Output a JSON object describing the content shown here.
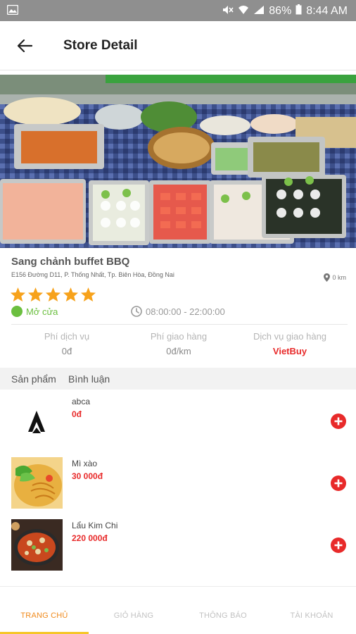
{
  "status_bar": {
    "battery": "86%",
    "time": "8:44 AM"
  },
  "header": {
    "title": "Store Detail"
  },
  "store": {
    "name": "Sang chảnh buffet BBQ",
    "address": "E156 Đường D11, P. Thống Nhất, Tp. Biên Hòa, Đồng Nai",
    "distance": "0 km",
    "rating": 5,
    "status": "Mở cửa",
    "hours": "08:00:00 - 22:00:00",
    "fees": [
      {
        "label": "Phí dịch vụ",
        "value": "0đ"
      },
      {
        "label": "Phí giao hàng",
        "value": "0đ/km"
      },
      {
        "label": "Dịch vụ giao hàng",
        "value": "VietBuy"
      }
    ]
  },
  "tabs": [
    "Sản phẩm",
    "Bình luận"
  ],
  "products": [
    {
      "name": "abca",
      "price": "0đ"
    },
    {
      "name": "Mì xào",
      "price": "30 000đ"
    },
    {
      "name": "Lẩu Kim Chi",
      "price": "220 000đ"
    }
  ],
  "bottom_nav": [
    "TRANG CHỦ",
    "GIỎ HÀNG",
    "THÔNG BÁO",
    "TÀI KHOẢN"
  ],
  "colors": {
    "accent": "#f08a1c",
    "indicator": "#f6c628",
    "price": "#e82a2a",
    "open": "#6bbf3f",
    "star": "#f7a21b"
  }
}
